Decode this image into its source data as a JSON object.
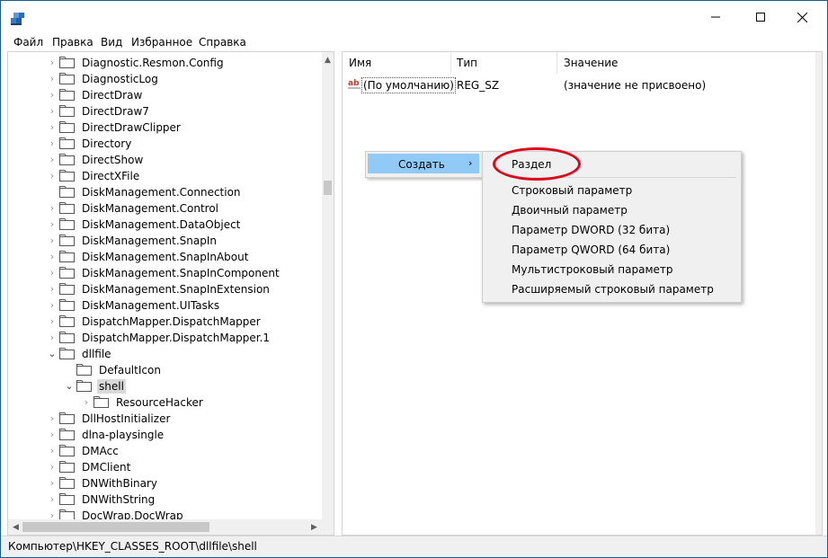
{
  "menubar": {
    "items": [
      "Файл",
      "Правка",
      "Вид",
      "Избранное",
      "Справка"
    ]
  },
  "tree": {
    "rows": [
      "Diagnostic.Resmon.Config",
      "DiagnosticLog",
      "DirectDraw",
      "DirectDraw7",
      "DirectDrawClipper",
      "Directory",
      "DirectShow",
      "DirectXFile",
      "DiskManagement.Connection",
      "DiskManagement.Control",
      "DiskManagement.DataObject",
      "DiskManagement.SnapIn",
      "DiskManagement.SnapInAbout",
      "DiskManagement.SnapInComponent",
      "DiskManagement.SnapInExtension",
      "DiskManagement.UITasks",
      "DispatchMapper.DispatchMapper",
      "DispatchMapper.DispatchMapper.1",
      "dllfile",
      "DefaultIcon",
      "shell",
      "ResourceHacker",
      "DllHostInitializer",
      "dlna-playsingle",
      "DMAcc",
      "DMClient",
      "DNWithBinary",
      "DNWithString",
      "DocWrap.DocWrap"
    ]
  },
  "list": {
    "columns": [
      "Имя",
      "Тип",
      "Значение"
    ],
    "rows": [
      {
        "name": "(По умолчанию)",
        "type": "REG_SZ",
        "value": "(значение не присвоено)"
      }
    ]
  },
  "context_menu": {
    "create_label": "Создать",
    "submenu": [
      "Раздел",
      "Строковый параметр",
      "Двоичный параметр",
      "Параметр DWORD (32 бита)",
      "Параметр QWORD (64 бита)",
      "Мультистроковый параметр",
      "Расширяемый строковый параметр"
    ]
  },
  "status": {
    "path": "Компьютер\\HKEY_CLASSES_ROOT\\dllfile\\shell"
  },
  "icons": {
    "app": "registry-editor-icon",
    "folder": "folder-icon",
    "value": "string-value-icon"
  },
  "colors": {
    "highlight": "#91c9f7",
    "annotation": "#e0071b",
    "border": "#1d5a8a"
  }
}
